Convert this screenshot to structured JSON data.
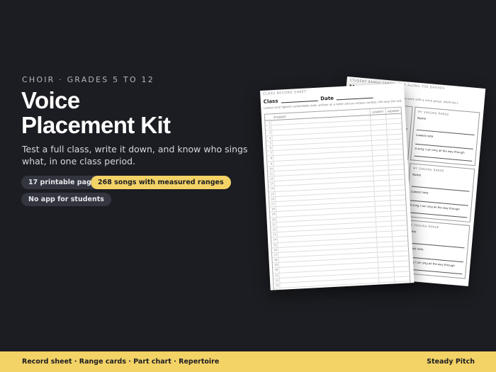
{
  "hero": {
    "eyebrow": "CHOIR · GRADES 5 TO 12",
    "title_line1": "Voice",
    "title_line2": "Placement Kit",
    "subtitle": "Test a full class, write it down, and know who sings what, in one class period."
  },
  "chips": [
    {
      "label": "17 printable pages",
      "style": "dark"
    },
    {
      "label": "268 songs with measured ranges",
      "style": "yellow"
    },
    {
      "label": "No app for students",
      "style": "dark"
    }
  ],
  "record_sheet": {
    "header": "CLASS RECORD SHEET",
    "class_label": "Class",
    "date_label": "Date",
    "description": "Lowest and highest comfortable note, written as a letter and an octave number, the way the rest",
    "columns": [
      "STUDENT",
      "LOWEST",
      "HIGHEST"
    ],
    "rows": [
      1,
      2,
      3,
      4,
      5,
      6,
      7,
      8,
      9,
      10,
      11,
      12,
      13,
      14,
      15,
      16,
      17,
      18,
      19,
      20,
      21,
      22,
      23,
      24,
      25,
      26,
      27,
      28,
      29,
      30,
      31,
      32,
      33,
      34,
      35
    ]
  },
  "range_cards": {
    "header": "STUDENT RANGE CARDS · CUT ALONG THE DASHES",
    "title": "My singing range",
    "description": "Fill this in yourself at the desks while you work with a voice group, while the t",
    "card_label": "MY SINGING RANGE",
    "name_label": "Name",
    "lowest_label": "Lowest note",
    "note_label": "A song I can sing all the way through"
  },
  "footer": {
    "items": "Record sheet · Range cards · Part chart · Repertoire",
    "brand": "Steady Pitch"
  },
  "colors": {
    "background": "#1c1d22",
    "accent_yellow": "#f3d266",
    "chip_dark": "#34363f"
  }
}
